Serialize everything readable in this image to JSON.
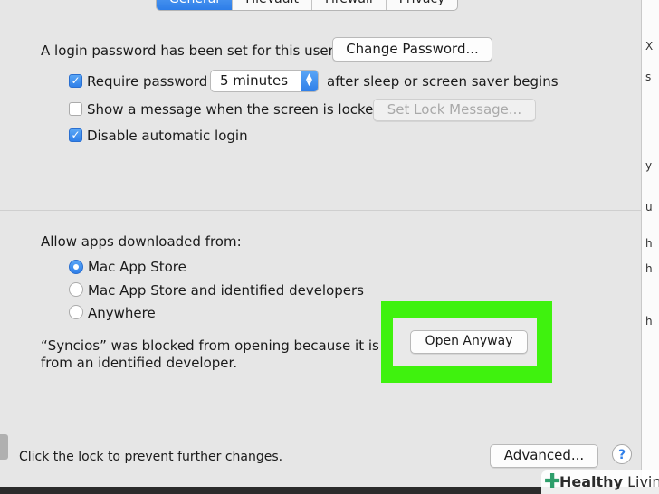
{
  "tabs": [
    "General",
    "FileVault",
    "Firewall",
    "Privacy"
  ],
  "login_password": {
    "text": "A login password has been set for this user",
    "change_button": "Change Password..."
  },
  "require_password": {
    "checked": true,
    "label": "Require password",
    "select_value": "5 minutes",
    "suffix": "after sleep or screen saver begins"
  },
  "show_message": {
    "checked": false,
    "label": "Show a message when the screen is locked",
    "button": "Set Lock Message..."
  },
  "disable_auto_login": {
    "checked": true,
    "label": "Disable automatic login"
  },
  "allow_apps": {
    "heading": "Allow apps downloaded from:",
    "options": [
      {
        "label": "Mac App Store",
        "selected": true
      },
      {
        "label": "Mac App Store and identified developers",
        "selected": false
      },
      {
        "label": "Anywhere",
        "selected": false
      }
    ]
  },
  "blocked_message": {
    "line1": "“Syncios” was blocked from opening because it is no",
    "line2": "from an identified developer."
  },
  "open_anyway_button": "Open Anyway",
  "highlight_color": "#3ff20e",
  "accent_color": "#2f7fe9",
  "footer": {
    "lock_text": "Click the lock to prevent further changes.",
    "advanced_button": "Advanced...",
    "help_glyph": "?"
  },
  "right_strip_chars": [
    "X",
    "s",
    "y",
    "u",
    "h",
    "h",
    "h"
  ],
  "watermark": {
    "bold": "Healthy",
    "light": " Living"
  }
}
